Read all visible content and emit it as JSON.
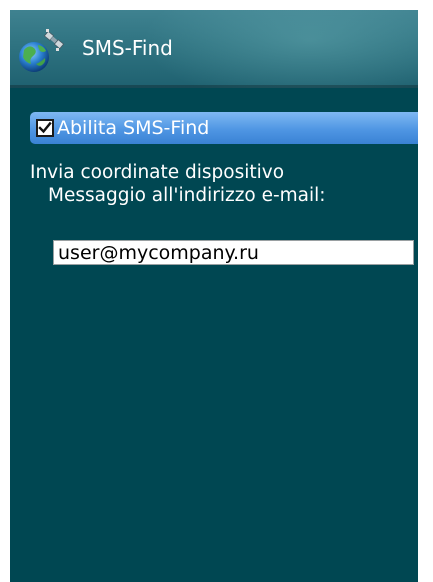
{
  "header": {
    "title": "SMS-Find",
    "icon": "satellite-globe-icon"
  },
  "enable_option": {
    "label": "Abilita SMS-Find",
    "checked": true
  },
  "description": {
    "line1": "Invia coordinate dispositivo",
    "line2": "Messaggio all'indirizzo e-mail:"
  },
  "email": {
    "value": "user@mycompany.ru"
  },
  "colors": {
    "background": "#004752",
    "highlight": "#4f96e3",
    "text": "#ffffff"
  }
}
